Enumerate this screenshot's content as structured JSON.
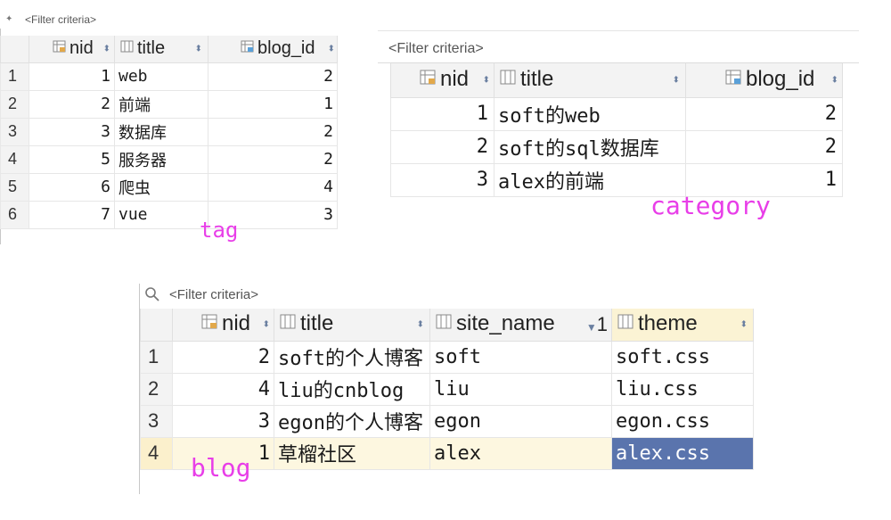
{
  "tag": {
    "filter_label": "<Filter criteria>",
    "headers": {
      "nid": "nid",
      "title": "title",
      "blog_id": "blog_id"
    },
    "rows": [
      {
        "num": "1",
        "nid": "1",
        "title": "web",
        "blog_id": "2"
      },
      {
        "num": "2",
        "nid": "2",
        "title": "前端",
        "blog_id": "1"
      },
      {
        "num": "3",
        "nid": "3",
        "title": "数据库",
        "blog_id": "2"
      },
      {
        "num": "4",
        "nid": "5",
        "title": "服务器",
        "blog_id": "2"
      },
      {
        "num": "5",
        "nid": "6",
        "title": "爬虫",
        "blog_id": "4"
      },
      {
        "num": "6",
        "nid": "7",
        "title": "vue",
        "blog_id": "3"
      }
    ],
    "annotation": "tag"
  },
  "category": {
    "filter_label": "<Filter criteria>",
    "headers": {
      "nid": "nid",
      "title": "title",
      "blog_id": "blog_id"
    },
    "rows": [
      {
        "nid": "1",
        "title": "soft的web",
        "blog_id": "2"
      },
      {
        "nid": "2",
        "title": "soft的sql数据库",
        "blog_id": "2"
      },
      {
        "nid": "3",
        "title": "alex的前端",
        "blog_id": "1"
      }
    ],
    "annotation": "category"
  },
  "blog": {
    "filter_label": "<Filter criteria>",
    "headers": {
      "nid": "nid",
      "title": "title",
      "site_name": "site_name",
      "site_sort_index": "1",
      "theme": "theme"
    },
    "rows": [
      {
        "num": "1",
        "nid": "2",
        "title": "soft的个人博客",
        "site_name": "soft",
        "theme": "soft.css"
      },
      {
        "num": "2",
        "nid": "4",
        "title": "liu的cnblog",
        "site_name": "liu",
        "theme": "liu.css"
      },
      {
        "num": "3",
        "nid": "3",
        "title": "egon的个人博客",
        "site_name": "egon",
        "theme": "egon.css"
      },
      {
        "num": "4",
        "nid": "1",
        "title": "草榴社区",
        "site_name": "alex",
        "theme": "alex.css"
      }
    ],
    "annotation": "blog"
  },
  "icons": {
    "key_column": "key-column-icon",
    "column": "column-icon",
    "filter": "filter-icon",
    "sort": "sort-arrows-icon"
  },
  "colors": {
    "annotation": "#e83ee8",
    "selected_row": "#fdf7e0",
    "selected_cell": "#5a74ad",
    "header": "#f3f3f3"
  }
}
